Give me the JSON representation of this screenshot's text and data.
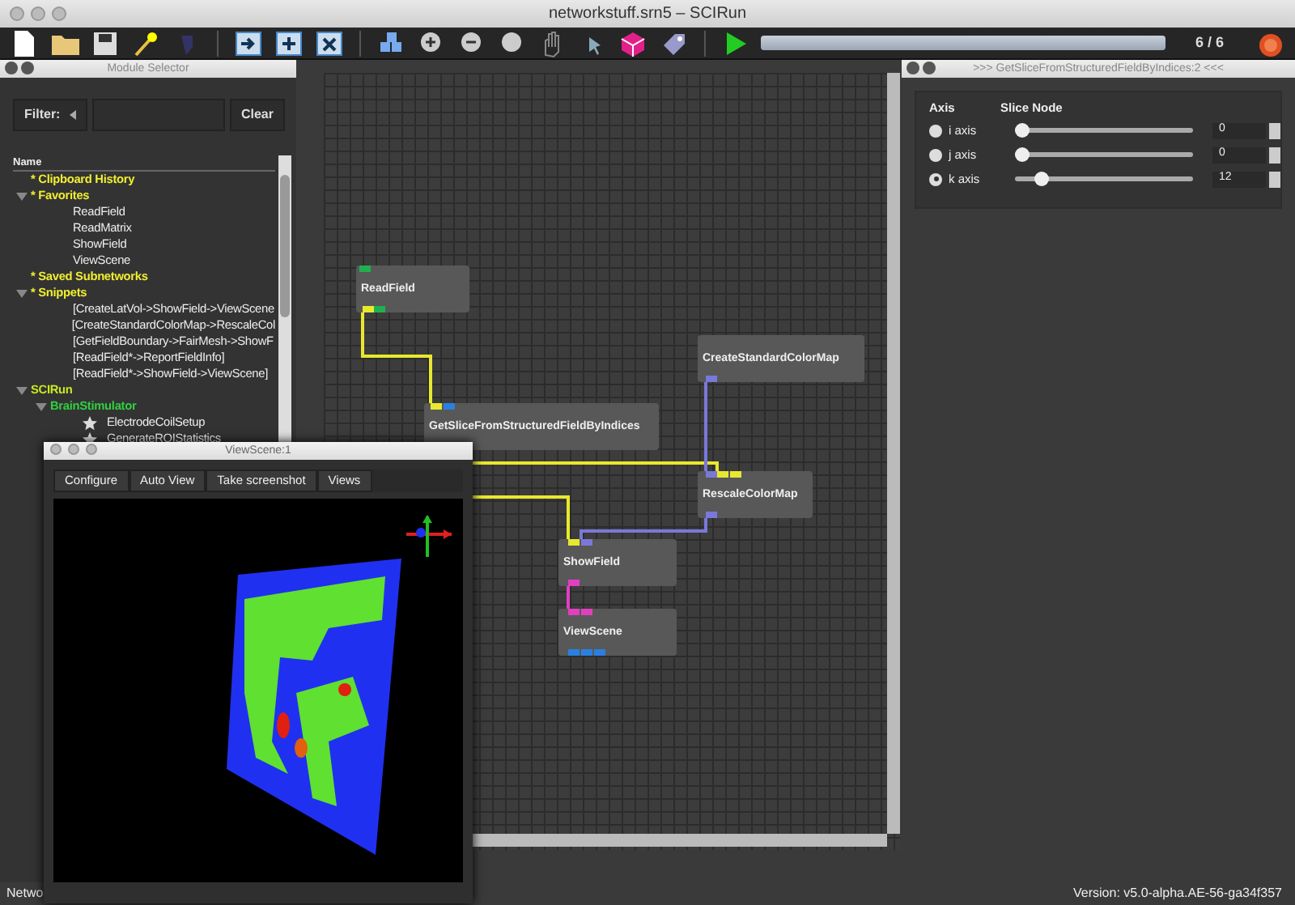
{
  "window": {
    "title": "networkstuff.srn5 – SCIRun"
  },
  "toolbar": {
    "progress": {
      "level": 1,
      "text": "6 / 6"
    }
  },
  "module_selector": {
    "title": "Module Selector",
    "filter_label": "Filter:",
    "clear_button": "Clear",
    "column": "Name",
    "tree": [
      {
        "label": "* Clipboard History",
        "kind": "category"
      },
      {
        "label": "* Favorites",
        "kind": "category",
        "expanded": true,
        "children": [
          {
            "label": "ReadField",
            "kind": "module"
          },
          {
            "label": "ReadMatrix",
            "kind": "module"
          },
          {
            "label": "ShowField",
            "kind": "module"
          },
          {
            "label": "ViewScene",
            "kind": "module"
          }
        ]
      },
      {
        "label": "* Saved Subnetworks",
        "kind": "category"
      },
      {
        "label": "* Snippets",
        "kind": "category",
        "expanded": true,
        "children": [
          {
            "label": "[CreateLatVol->ShowField->ViewScene",
            "kind": "module"
          },
          {
            "label": "[CreateStandardColorMap->RescaleCol",
            "kind": "module"
          },
          {
            "label": "[GetFieldBoundary->FairMesh->ShowF",
            "kind": "module"
          },
          {
            "label": "[ReadField*->ReportFieldInfo]",
            "kind": "module"
          },
          {
            "label": "[ReadField*->ShowField->ViewScene]",
            "kind": "module"
          }
        ]
      },
      {
        "label": "SCIRun",
        "kind": "package",
        "expanded": true,
        "children": [
          {
            "label": "BrainStimulator",
            "kind": "subpackage",
            "expanded": true,
            "children": [
              {
                "label": "ElectrodeCoilSetup",
                "kind": "starred"
              },
              {
                "label": "GenerateROIStatistics",
                "kind": "starred"
              }
            ]
          }
        ]
      }
    ]
  },
  "network": {
    "modules": [
      {
        "name": "ReadField"
      },
      {
        "name": "GetSliceFromStructuredFieldByIndices"
      },
      {
        "name": "CreateStandardColorMap"
      },
      {
        "name": "RescaleColorMap"
      },
      {
        "name": "ShowField"
      },
      {
        "name": "ViewScene"
      }
    ]
  },
  "slice_panel": {
    "title": ">>> GetSliceFromStructuredFieldByIndices:2 <<<",
    "columns": [
      "Axis",
      "Slice Node"
    ],
    "axes": [
      {
        "label": "i axis",
        "selected": false,
        "level": 0,
        "value": "0"
      },
      {
        "label": "j axis",
        "selected": false,
        "level": 0,
        "value": "0"
      },
      {
        "label": "k axis",
        "selected": true,
        "level": 0.12,
        "value": "12"
      }
    ]
  },
  "viewscene": {
    "title": "ViewScene:1",
    "buttons": [
      "Configure",
      "Auto View",
      "Take screenshot",
      "Views"
    ]
  },
  "status_bar": {
    "left": "Netwo",
    "version": "Version: v5.0-alpha.AE-56-ga34f357"
  }
}
